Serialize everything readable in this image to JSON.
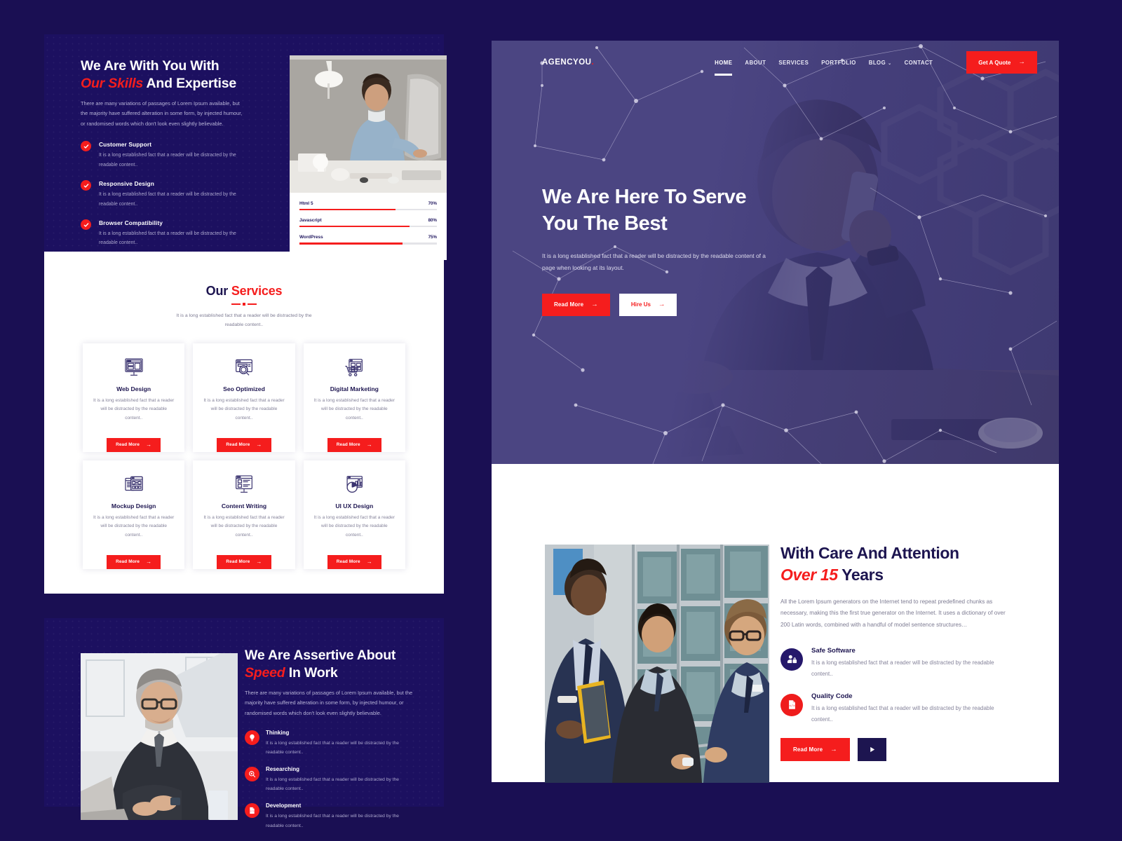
{
  "brand": {
    "name": "AGENCYOU",
    "dot": "."
  },
  "nav": {
    "items": [
      {
        "label": "HOME",
        "active": true
      },
      {
        "label": "ABOUT",
        "active": false
      },
      {
        "label": "SERVICES",
        "active": false
      },
      {
        "label": "PORTFOLIO",
        "active": false
      },
      {
        "label": "BLOG",
        "active": false,
        "caret": "⌄"
      },
      {
        "label": "CONTACT",
        "active": false
      }
    ],
    "cta": {
      "label": "Get A Quote",
      "arrow": "→"
    }
  },
  "hero": {
    "title_line1": "We Are Here To Serve",
    "title_line2": "You The Best",
    "paragraph": "It is a long established fact that a reader will be distracted by the readable content of a page when looking at its layout.",
    "primary_btn": {
      "label": "Read More",
      "arrow": "→"
    },
    "secondary_btn": {
      "label": "Hire Us",
      "arrow": "→"
    }
  },
  "skills": {
    "title_line1": "We Are With You With",
    "title_red": "Our Skills",
    "title_rest": " And Expertise",
    "paragraph": "There are many variations of passages of Lorem Ipsum available, but the majority have suffered alteration in some form, by injected humour, or randomised words which don't look even slightly believable.",
    "features": [
      {
        "icon": "check-icon",
        "title": "Customer Support",
        "desc": "It is a long established fact that a reader will be distracted by the readable content.."
      },
      {
        "icon": "check-icon",
        "title": "Responsive Design",
        "desc": "It is a long established fact that a reader will be distracted by the readable content.."
      },
      {
        "icon": "check-icon",
        "title": "Browser Compatibility",
        "desc": "It is a long established fact that a reader will be distracted by the readable content.."
      }
    ],
    "bars": [
      {
        "label": "Html 5",
        "percent_label": "70%",
        "percent": 70
      },
      {
        "label": "Javascript",
        "percent_label": "80%",
        "percent": 80
      },
      {
        "label": "WordPress",
        "percent_label": "75%",
        "percent": 75
      }
    ]
  },
  "services": {
    "title_first": "Our ",
    "title_red": "Services",
    "subtitle": "It is a long established fact that a reader will be distracted by the readable content..",
    "cards": [
      {
        "icon": "monitor-layout-icon",
        "name": "Web Design",
        "desc": "It is a long established fact that a reader will be distracted by the readable content..",
        "btn": "Read More",
        "arrow": "→"
      },
      {
        "icon": "browser-search-icon",
        "name": "Seo Optimized",
        "desc": "It is a long established fact that a reader will be distracted by the readable content..",
        "btn": "Read More",
        "arrow": "→"
      },
      {
        "icon": "shopping-cart-grid-icon",
        "name": "Digital Marketing",
        "desc": "It is a long established fact that a reader will be distracted by the readable content..",
        "btn": "Read More",
        "arrow": "→"
      },
      {
        "icon": "wireframe-stack-icon",
        "name": "Mockup Design",
        "desc": "It is a long established fact that a reader will be distracted by the readable content..",
        "btn": "Read More",
        "arrow": "→"
      },
      {
        "icon": "monitor-article-icon",
        "name": "Content Writing",
        "desc": "It is a long established fact that a reader will be distracted by the readable content..",
        "btn": "Read More",
        "arrow": "→"
      },
      {
        "icon": "pie-bar-chart-icon",
        "name": "UI UX Design",
        "desc": "It is a long established fact that a reader will be distracted by the readable content..",
        "btn": "Read More",
        "arrow": "→"
      }
    ]
  },
  "assertive": {
    "title_line1": "We Are Assertive About",
    "title_red": "Speed",
    "title_rest": " In Work",
    "paragraph": "There are many variations of passages of Lorem Ipsum available, but the majority have suffered alteration in some form, by injected humour, or randomised words which don't look even slightly believable.",
    "items": [
      {
        "icon": "lightbulb-icon",
        "title": "Thinking",
        "desc": "It is a long established fact that a reader will be distracted by the readable content.."
      },
      {
        "icon": "magnifier-icon",
        "title": "Researching",
        "desc": "It is a long established fact that a reader will be distracted by the readable content.."
      },
      {
        "icon": "code-file-icon",
        "title": "Development",
        "desc": "It is a long established fact that a reader will be distracted by the readable content.."
      }
    ]
  },
  "care": {
    "title_line1": "With Care And Attention",
    "title_red": "Over 15",
    "title_rest": " Years",
    "paragraph": "All the Lorem Ipsum generators on the Internet tend to repeat predefined chunks as necessary, making this the first true generator on the Internet. It uses a dictionary of over 200 Latin words, combined with a handful of model sentence structures…",
    "items": [
      {
        "icon": "user-lock-icon",
        "title": "Safe Software",
        "desc": "It is a long established fact that a reader will be distracted by the readable content..",
        "color": "#25186b"
      },
      {
        "icon": "code-file-icon",
        "title": "Quality Code",
        "desc": "It is a long established fact that a reader will be distracted by the readable content..",
        "color": "#ef1c1c"
      }
    ],
    "primary_btn": {
      "label": "Read More",
      "arrow": "→"
    },
    "play_btn": {
      "icon": "play-icon"
    }
  },
  "colors": {
    "page_background": "#1a0f53",
    "panel_navy": "#1c1060",
    "accent_red": "#f51d1d",
    "heading_navy": "#1d1550",
    "hero_overlay": "#4b4582",
    "white": "#ffffff"
  }
}
